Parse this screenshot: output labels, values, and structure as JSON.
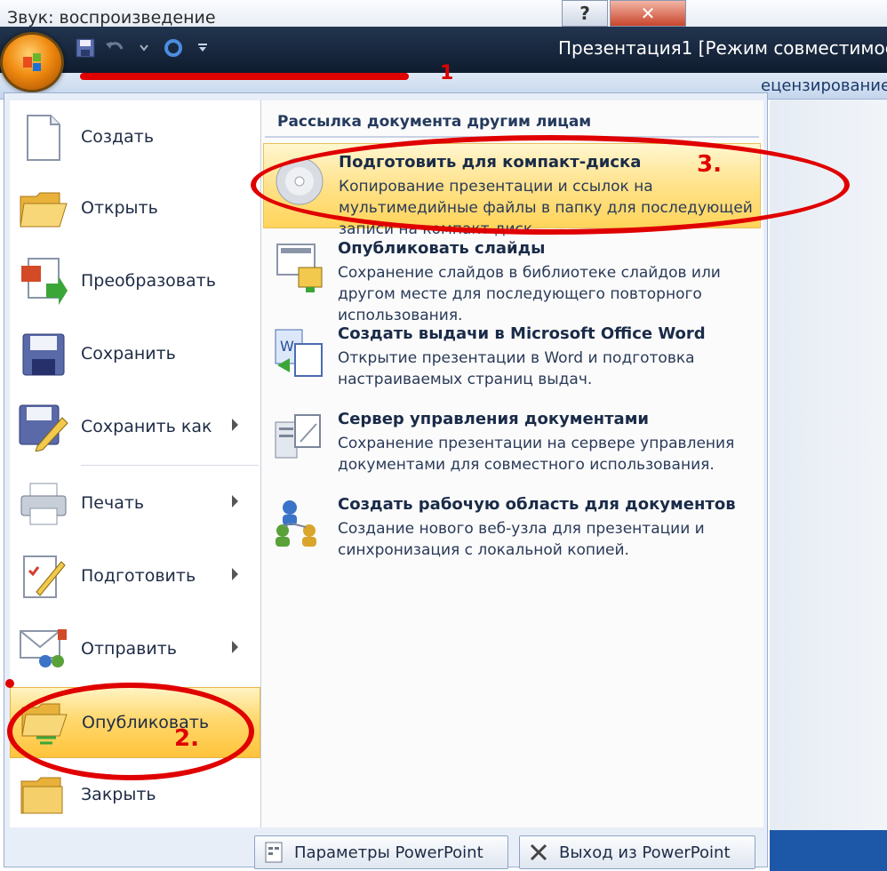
{
  "window": {
    "caption": "Звук: воспроизведение",
    "help_glyph": "?",
    "close_glyph": "✕",
    "title": "Презентация1 [Режим совместимос",
    "ribbon_tab": "ецензирование"
  },
  "annotations": {
    "one": "1",
    "two": "2.",
    "three": "3."
  },
  "menu": {
    "items": [
      {
        "label": "Создать",
        "icon": "new-document-icon",
        "submenu": false
      },
      {
        "label": "Открыть",
        "icon": "open-folder-icon",
        "submenu": false
      },
      {
        "label": "Преобразовать",
        "icon": "convert-icon",
        "submenu": false
      },
      {
        "label": "Сохранить",
        "icon": "save-icon",
        "submenu": false
      },
      {
        "label": "Сохранить как",
        "icon": "save-as-icon",
        "submenu": true
      },
      {
        "label": "Печать",
        "icon": "printer-icon",
        "submenu": true
      },
      {
        "label": "Подготовить",
        "icon": "prepare-icon",
        "submenu": true
      },
      {
        "label": "Отправить",
        "icon": "send-icon",
        "submenu": true
      },
      {
        "label": "Опубликовать",
        "icon": "publish-icon",
        "submenu": false,
        "active": true
      },
      {
        "label": "Закрыть",
        "icon": "close-folder-icon",
        "submenu": false
      }
    ]
  },
  "publish_pane": {
    "header": "Рассылка документа другим лицам",
    "items": [
      {
        "title": "Подготовить для компакт-диска",
        "desc": "Копирование презентации и ссылок на мультимедийные файлы в папку для последующей записи на компакт-диск.",
        "icon": "cd-icon",
        "highlight": true
      },
      {
        "title": "Опубликовать слайды",
        "desc": "Сохранение слайдов в библиотеке слайдов или другом месте для последующего повторного использования.",
        "icon": "publish-slides-icon"
      },
      {
        "title": "Создать выдачи в Microsoft Office Word",
        "desc": "Открытие презентации в Word и подготовка настраиваемых страниц выдач.",
        "icon": "word-handouts-icon"
      },
      {
        "title": "Сервер управления документами",
        "desc": "Сохранение презентации на сервере управления документами для совместного использования.",
        "icon": "document-server-icon"
      },
      {
        "title": "Создать рабочую область для документов",
        "desc": "Создание нового веб-узла для презентации и синхронизация с локальной копией.",
        "icon": "workspace-icon"
      }
    ]
  },
  "footer": {
    "options_label": "Параметры PowerPoint",
    "exit_label": "Выход из PowerPoint"
  }
}
